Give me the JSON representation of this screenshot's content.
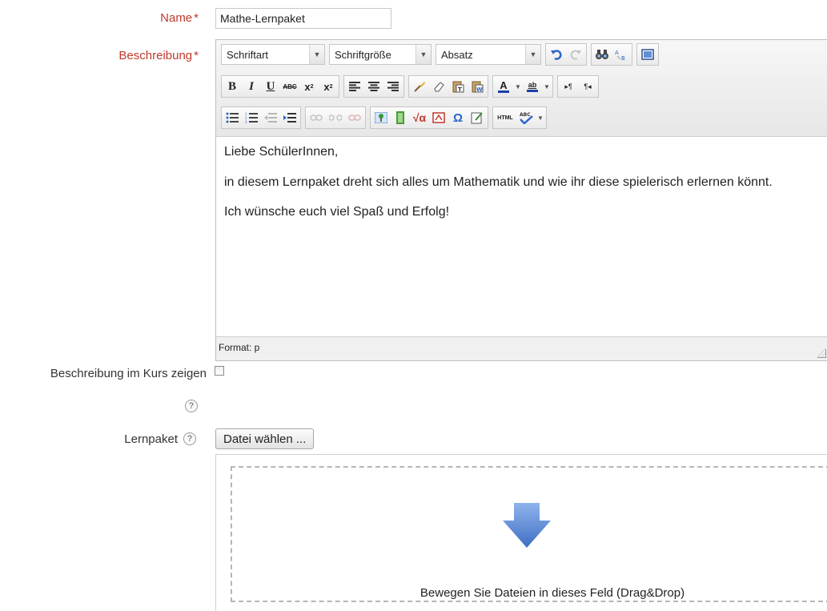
{
  "form": {
    "name_label": "Name",
    "required_marker": "*",
    "name_value": "Mathe-Lernpaket",
    "description_label": "Beschreibung",
    "show_in_course_label": "Beschreibung im Kurs zeigen",
    "show_in_course_checked": false,
    "package_label": "Lernpaket",
    "file_button": "Datei wählen ...",
    "drop_text": "Bewegen Sie Dateien in dieses Feld (Drag&Drop)",
    "help_glyph": "?"
  },
  "editor": {
    "font_select": "Schriftart",
    "size_select": "Schriftgröße",
    "format_select": "Absatz",
    "paragraphs": [
      "Liebe SchülerInnen,",
      "in diesem Lernpaket dreht sich alles um Mathematik und wie ihr diese spielerisch erlernen könnt.",
      "Ich wünsche euch viel Spaß und Erfolg!"
    ],
    "status": "Format: p",
    "toolbar_icons": [
      "undo-icon",
      "redo-icon",
      "find-icon",
      "replace-icon",
      "fullscreen-icon",
      "bold-icon",
      "italic-icon",
      "underline-icon",
      "strikethrough-icon",
      "subscript-icon",
      "superscript-icon",
      "align-left-icon",
      "align-center-icon",
      "align-right-icon",
      "cleanup-icon",
      "remove-format-icon",
      "paste-text-icon",
      "paste-word-icon",
      "text-color-icon",
      "highlight-icon",
      "ltr-icon",
      "rtl-icon",
      "bullet-list-icon",
      "numbered-list-icon",
      "outdent-icon",
      "indent-icon",
      "link-icon",
      "unlink-icon",
      "anchor-icon",
      "image-icon",
      "media-icon",
      "equation-icon",
      "emoticon-icon",
      "special-char-icon",
      "template-icon",
      "html-icon",
      "spellcheck-icon"
    ]
  },
  "colors": {
    "required": "#c0392b",
    "toolbar_bg": "#ececec",
    "arrow_blue": "#4a7fd4"
  }
}
